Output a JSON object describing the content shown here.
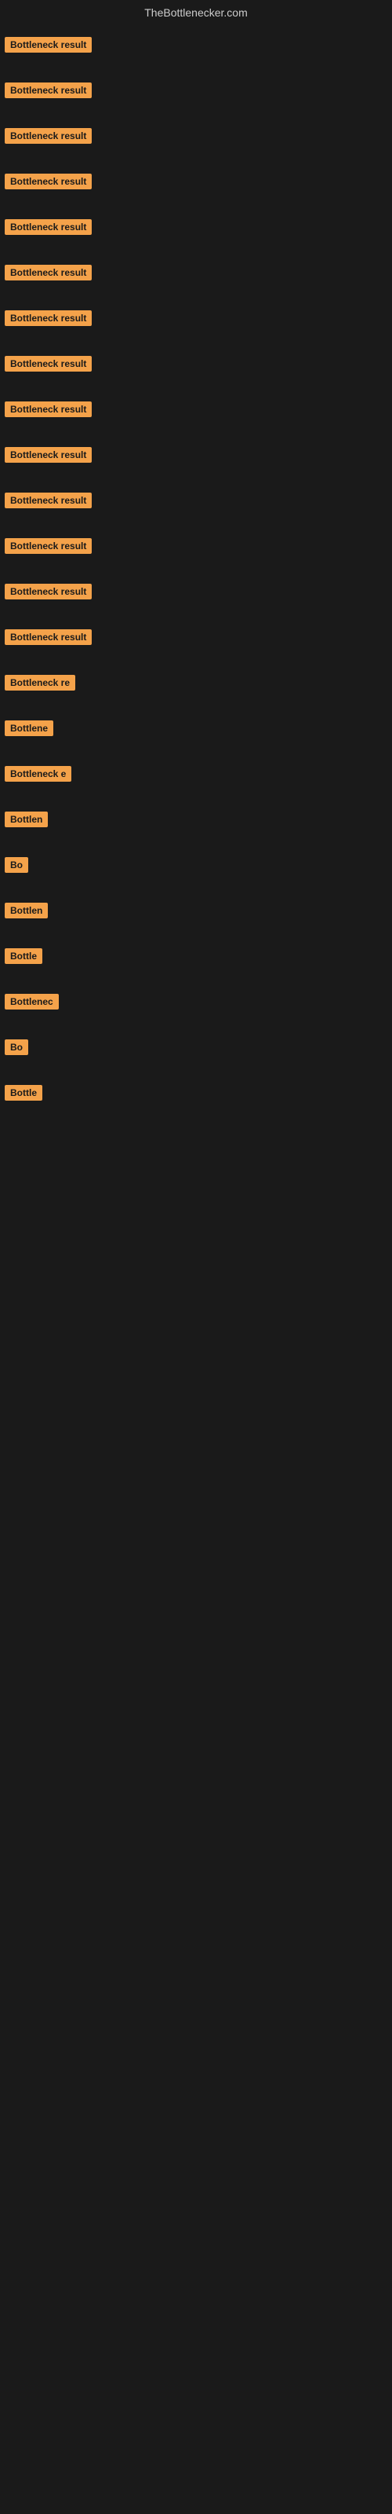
{
  "header": {
    "title": "TheBottlenecker.com"
  },
  "rows": [
    {
      "id": 1,
      "label": "Bottleneck result",
      "visible_chars": 16
    },
    {
      "id": 2,
      "label": "Bottleneck result",
      "visible_chars": 16
    },
    {
      "id": 3,
      "label": "Bottleneck result",
      "visible_chars": 16
    },
    {
      "id": 4,
      "label": "Bottleneck result",
      "visible_chars": 16
    },
    {
      "id": 5,
      "label": "Bottleneck result",
      "visible_chars": 16
    },
    {
      "id": 6,
      "label": "Bottleneck result",
      "visible_chars": 16
    },
    {
      "id": 7,
      "label": "Bottleneck result",
      "visible_chars": 16
    },
    {
      "id": 8,
      "label": "Bottleneck result",
      "visible_chars": 16
    },
    {
      "id": 9,
      "label": "Bottleneck result",
      "visible_chars": 16
    },
    {
      "id": 10,
      "label": "Bottleneck result",
      "visible_chars": 16
    },
    {
      "id": 11,
      "label": "Bottleneck result",
      "visible_chars": 16
    },
    {
      "id": 12,
      "label": "Bottleneck result",
      "visible_chars": 16
    },
    {
      "id": 13,
      "label": "Bottleneck result",
      "visible_chars": 16
    },
    {
      "id": 14,
      "label": "Bottleneck result",
      "visible_chars": 16
    },
    {
      "id": 15,
      "label": "Bottleneck re",
      "visible_chars": 13
    },
    {
      "id": 16,
      "label": "Bottlene",
      "visible_chars": 8
    },
    {
      "id": 17,
      "label": "Bottleneck e",
      "visible_chars": 12
    },
    {
      "id": 18,
      "label": "Bottlen",
      "visible_chars": 7
    },
    {
      "id": 19,
      "label": "Bo",
      "visible_chars": 2
    },
    {
      "id": 20,
      "label": "Bottlen",
      "visible_chars": 7
    },
    {
      "id": 21,
      "label": "Bottle",
      "visible_chars": 6
    },
    {
      "id": 22,
      "label": "Bottlenec",
      "visible_chars": 9
    },
    {
      "id": 23,
      "label": "Bo",
      "visible_chars": 2
    },
    {
      "id": 24,
      "label": "Bottle",
      "visible_chars": 6
    }
  ],
  "colors": {
    "badge_bg": "#f4a24a",
    "badge_text": "#1a1a1a",
    "background": "#1a1a1a",
    "header_text": "#cccccc"
  }
}
